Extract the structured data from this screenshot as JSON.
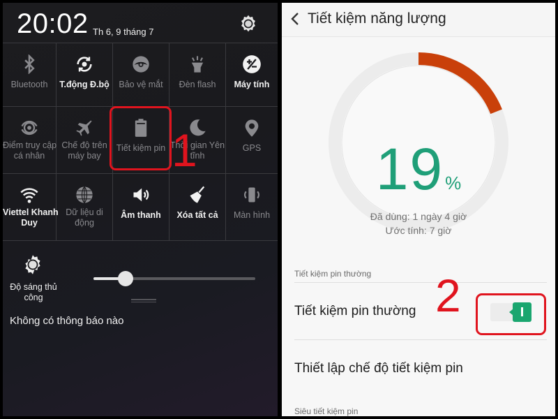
{
  "quick_settings": {
    "time": "20:02",
    "date": "Th 6, 9 tháng 7",
    "tiles": [
      {
        "label": "Bluetooth",
        "icon": "bluetooth-icon",
        "active": false
      },
      {
        "label": "T.động Đ.bộ",
        "icon": "sync-icon",
        "active": true
      },
      {
        "label": "Bảo vệ mắt",
        "icon": "eye-icon",
        "active": false
      },
      {
        "label": "Đèn flash",
        "icon": "flashlight-icon",
        "active": false
      },
      {
        "label": "Máy tính",
        "icon": "calculator-icon",
        "active": true
      },
      {
        "label": "Điểm truy cập cá nhân",
        "line1": "Điểm truy cập",
        "line2": "cá nhân",
        "icon": "hotspot-icon",
        "active": false
      },
      {
        "label": "Chế độ trên máy bay",
        "line1": "Chế độ trên",
        "line2": "máy bay",
        "icon": "airplane-icon",
        "active": false
      },
      {
        "label": "Tiết kiệm pin",
        "icon": "battery-icon",
        "active": false
      },
      {
        "label": "Thời gian Yên tĩnh",
        "line1": "Thời gian Yên",
        "line2": "tĩnh",
        "icon": "moon-icon",
        "active": false
      },
      {
        "label": "GPS",
        "icon": "gps-icon",
        "active": false
      },
      {
        "label": "Viettel Khanh Duy",
        "line1": "Viettel Khanh",
        "line2": "Duy",
        "icon": "wifi-icon",
        "active": true
      },
      {
        "label": "Dữ liệu di động",
        "line1": "Dữ liệu di",
        "line2": "động",
        "icon": "globe-icon",
        "active": false
      },
      {
        "label": "Âm thanh",
        "icon": "speaker-icon",
        "active": true
      },
      {
        "label": "Xóa tất cả",
        "icon": "broom-icon",
        "active": true
      },
      {
        "label": "Màn hình",
        "icon": "screen-rotate-icon",
        "active": false
      }
    ],
    "brightness": {
      "label_line1": "Độ sáng thủ",
      "label_line2": "công",
      "level": 0.2
    },
    "no_notifications": "Không có thông báo nào",
    "annotation_1": "1"
  },
  "power_saving": {
    "title": "Tiết kiệm năng lượng",
    "battery_percent": "19",
    "battery_percent_value": 19,
    "percent_sign": "%",
    "used": "Đã dùng: 1 ngày 4 giờ",
    "estimated": "Ước tính: 7 giờ",
    "section_normal": "Tiết kiệm pin thường",
    "normal_saver_label": "Tiết kiệm pin thường",
    "normal_saver_on": true,
    "setup_label": "Thiết lập chế độ tiết kiệm pin",
    "section_super": "Siêu tiết kiệm pin",
    "annotation_2": "2"
  },
  "colors": {
    "accent_green": "#1aa66f",
    "battery_text_green": "#1f9f78",
    "battery_arc_orange": "#c9400a",
    "annotation_red": "#e0141e"
  }
}
